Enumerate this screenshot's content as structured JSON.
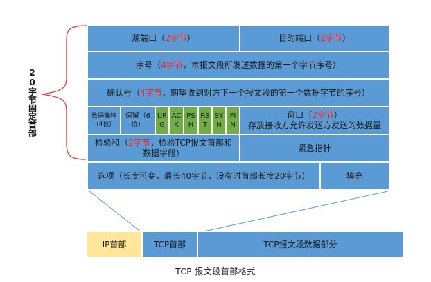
{
  "brace_label": "20字节固定首部",
  "header": {
    "row1": {
      "src_port": [
        "源端口（",
        "2字节",
        "）"
      ],
      "dst_port": [
        "目的端口（",
        "2字节",
        "）"
      ]
    },
    "row2": {
      "seq": [
        "序号（",
        "4字节",
        "，本报文段所发送数据的第一个字节序号）"
      ]
    },
    "row3": {
      "ack": [
        "确认号（",
        "4字节",
        "，期望收到对方下一个报文段的第一个数据字节的序号）"
      ]
    },
    "row4": {
      "data_offset": [
        "数据偏移",
        "（4位）"
      ],
      "reserved": [
        "保留（6",
        "位）"
      ],
      "flags": [
        [
          "UR",
          "G"
        ],
        [
          "AC",
          "K"
        ],
        [
          "PS",
          "H"
        ],
        [
          "RS",
          "T"
        ],
        [
          "SY",
          "N"
        ],
        [
          "FI",
          "N"
        ]
      ],
      "window": [
        "窗口（",
        "2字节",
        "）",
        "存放接收方允许发送方发送的数据量"
      ]
    },
    "row5": {
      "checksum": [
        "检验和（",
        "2字节",
        "，检验TCP报文首部和",
        "数据字段）"
      ],
      "urgent": "紧急指针"
    },
    "row6": {
      "options": "选项（长度可变，最长40字节，没有时首部长度20字节）",
      "padding": "填充"
    }
  },
  "packet": {
    "ip": "IP首部",
    "tcp": "TCP首部",
    "data": "TCP报文段数据部分"
  },
  "caption": "TCP 报文段首部格式",
  "colors": {
    "cell_blue": "#5b9bd5",
    "flag_green": "#70ad47",
    "ip_yellow": "#ffe699",
    "highlight_red": "#ff1a1a",
    "brace_red": "#e53935"
  }
}
